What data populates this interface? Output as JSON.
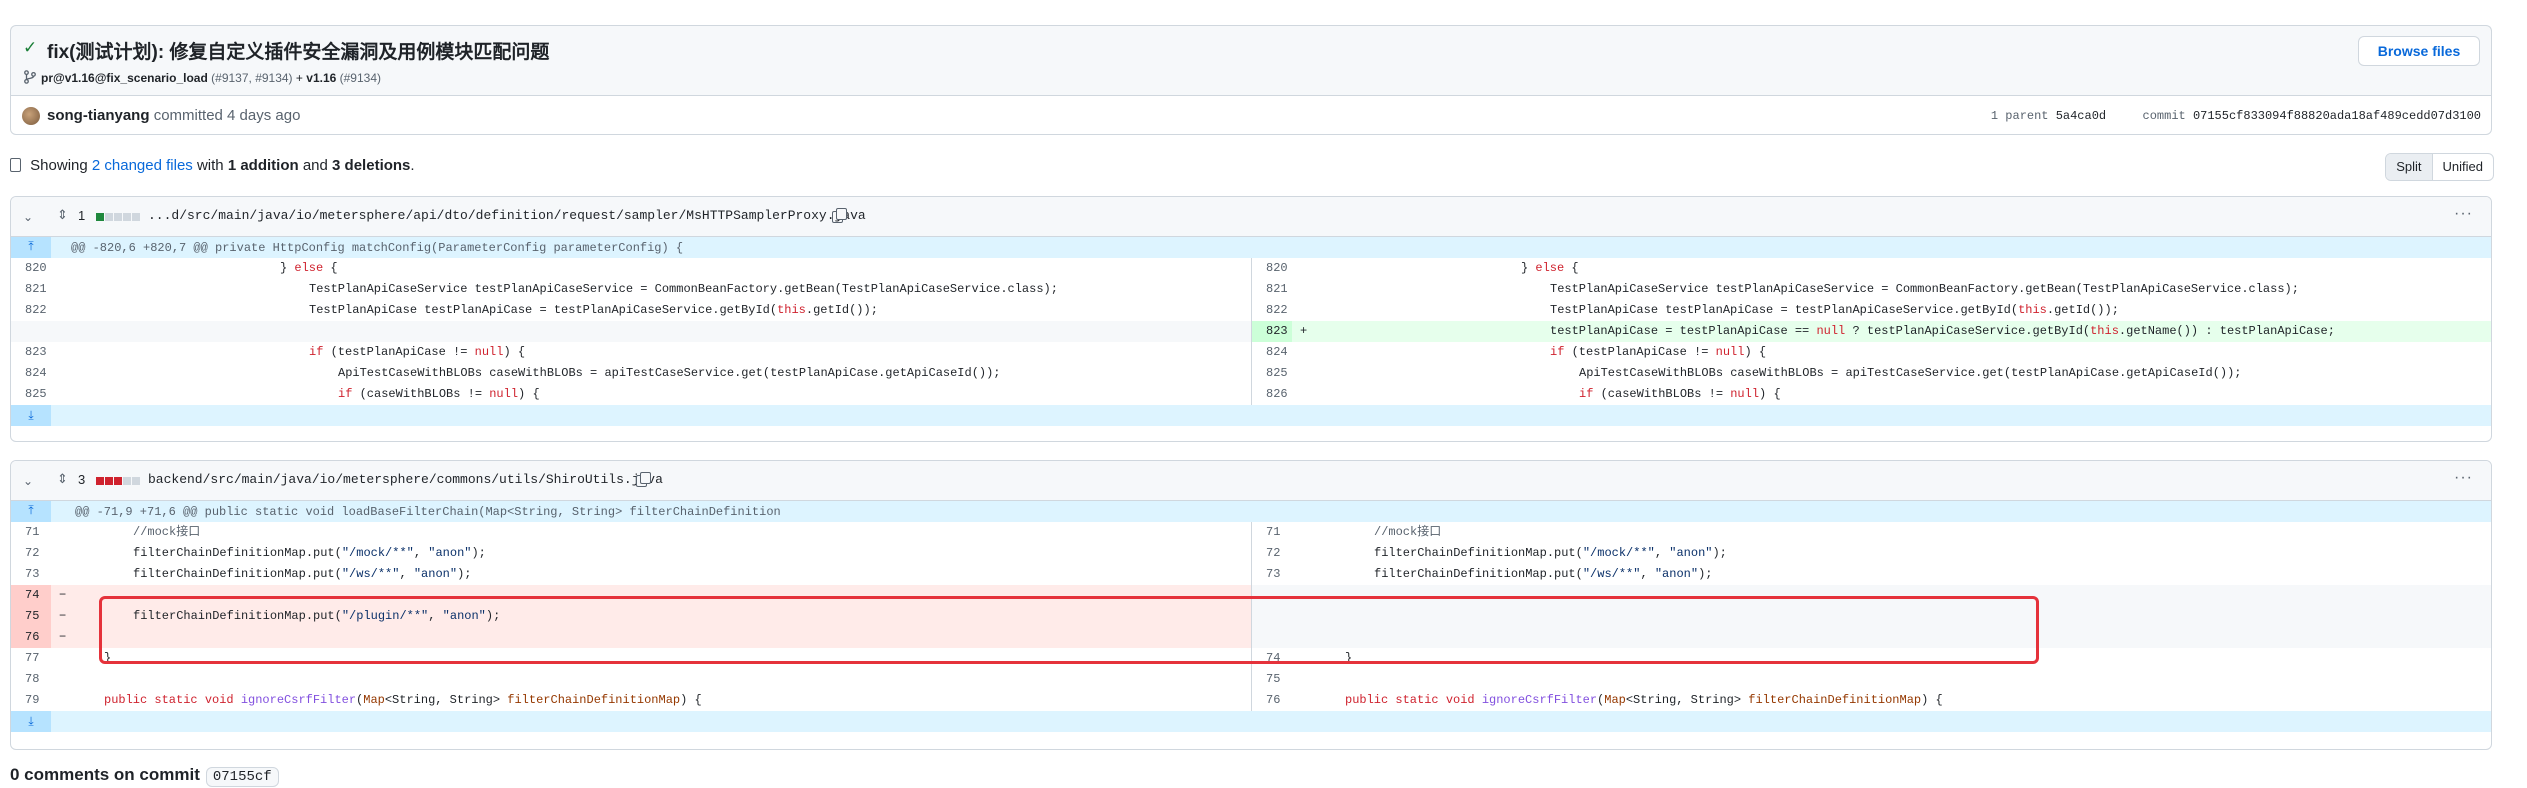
{
  "commit": {
    "title": "fix(测试计划): 修复自定义插件安全漏洞及用例模块匹配问题",
    "branch": "pr@v1.16@fix_scenario_load",
    "prs": "(#9137, #9134)",
    "plus": "+",
    "tag": "v1.16",
    "tag_pr": "(#9134)",
    "browse_label": "Browse files",
    "author": "song-tianyang",
    "committed_text": "committed 4 days ago",
    "parent_label": "1 parent",
    "parent_sha": "5a4ca0d",
    "commit_label": "commit",
    "commit_sha": "07155cf833094f88820ada18af489cedd07d3100"
  },
  "summary": {
    "showing": "Showing",
    "changed_files": "2 changed files",
    "with": "with",
    "additions": "1 addition",
    "and": "and",
    "deletions": "3 deletions",
    "period": ".",
    "split_label": "Split",
    "unified_label": "Unified"
  },
  "files": [
    {
      "count": "1",
      "path": "...d/src/main/java/io/metersphere/api/dto/definition/request/sampler/MsHTTPSamplerProxy.java",
      "diffstat": {
        "additions": 1,
        "deletions": 0
      },
      "hunk": "@@ -820,6 +820,7 @@ private HttpConfig matchConfig(ParameterConfig parameterConfig) {",
      "left_nums": [
        "820",
        "821",
        "822",
        "",
        "823",
        "824",
        "825"
      ],
      "right_nums": [
        "820",
        "821",
        "822",
        "823",
        "824",
        "825",
        "826"
      ],
      "added_sign": "+"
    },
    {
      "count": "3",
      "path": "backend/src/main/java/io/metersphere/commons/utils/ShiroUtils.java",
      "diffstat": {
        "additions": 0,
        "deletions": 3
      },
      "hunk": "@@ -71,9 +71,6 @@ public static void loadBaseFilterChain(Map<String, String> filterChainDefinition",
      "left_nums": [
        "71",
        "72",
        "73",
        "74",
        "75",
        "76",
        "77",
        "78",
        "79"
      ],
      "right_nums": [
        "71",
        "72",
        "73",
        "",
        "",
        "",
        "74",
        "75",
        "76"
      ],
      "deleted_sign": "−",
      "deleted_code": "filterChainDefinitionMap.put(\"/plugin/**\", \"anon\");",
      "comment_code": "//mock接口"
    }
  ],
  "comments": {
    "label": "0 comments on commit",
    "sha": "07155cf"
  }
}
